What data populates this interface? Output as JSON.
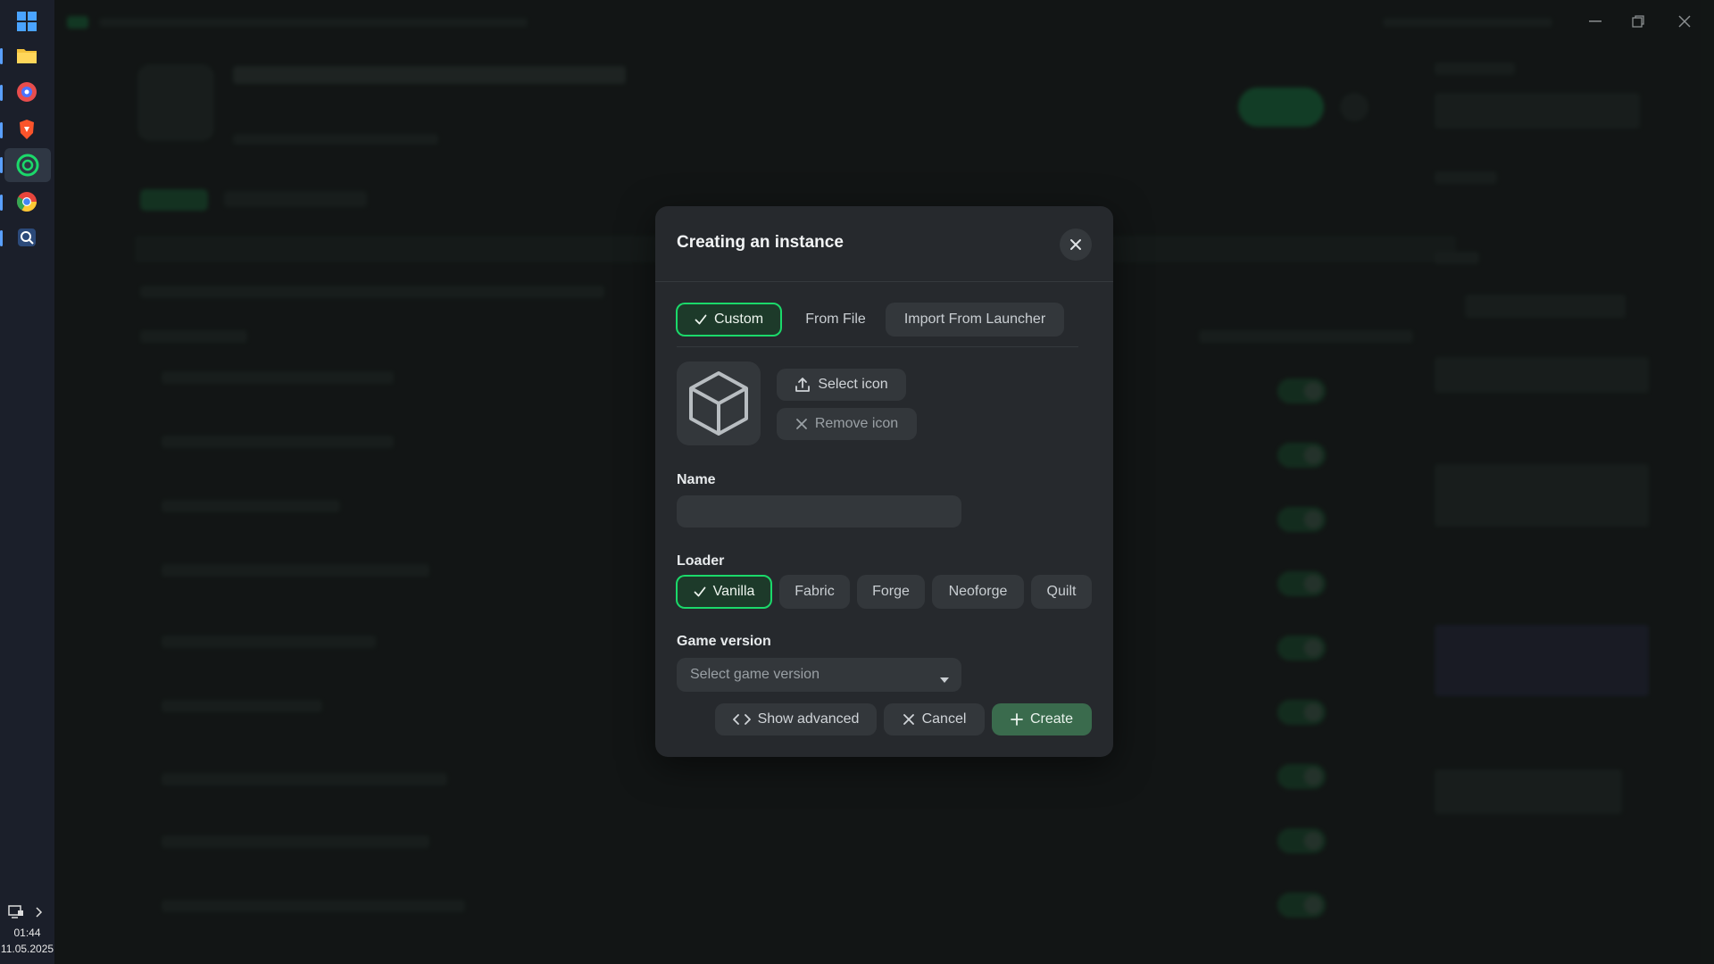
{
  "modal": {
    "title": "Creating an instance",
    "tabs": [
      {
        "label": "Custom",
        "selected": true
      },
      {
        "label": "From File",
        "selected": false
      },
      {
        "label": "Import From Launcher",
        "selected": false
      }
    ],
    "icon_actions": {
      "select_label": "Select icon",
      "remove_label": "Remove icon"
    },
    "name_label": "Name",
    "name_value": "",
    "loader_label": "Loader",
    "loaders": [
      {
        "label": "Vanilla",
        "selected": true
      },
      {
        "label": "Fabric",
        "selected": false
      },
      {
        "label": "Forge",
        "selected": false
      },
      {
        "label": "Neoforge",
        "selected": false
      },
      {
        "label": "Quilt",
        "selected": false
      }
    ],
    "game_version_label": "Game version",
    "game_version_placeholder": "Select game version",
    "footer": {
      "advanced_label": "Show advanced",
      "cancel_label": "Cancel",
      "create_label": "Create"
    }
  },
  "taskbar": {
    "time": "01:44",
    "date": "11.05.2025"
  },
  "colors": {
    "accent": "#1bd96a",
    "modal_bg": "#26292d",
    "chip_bg": "#33373b",
    "create_bg": "#3a6b4d"
  }
}
